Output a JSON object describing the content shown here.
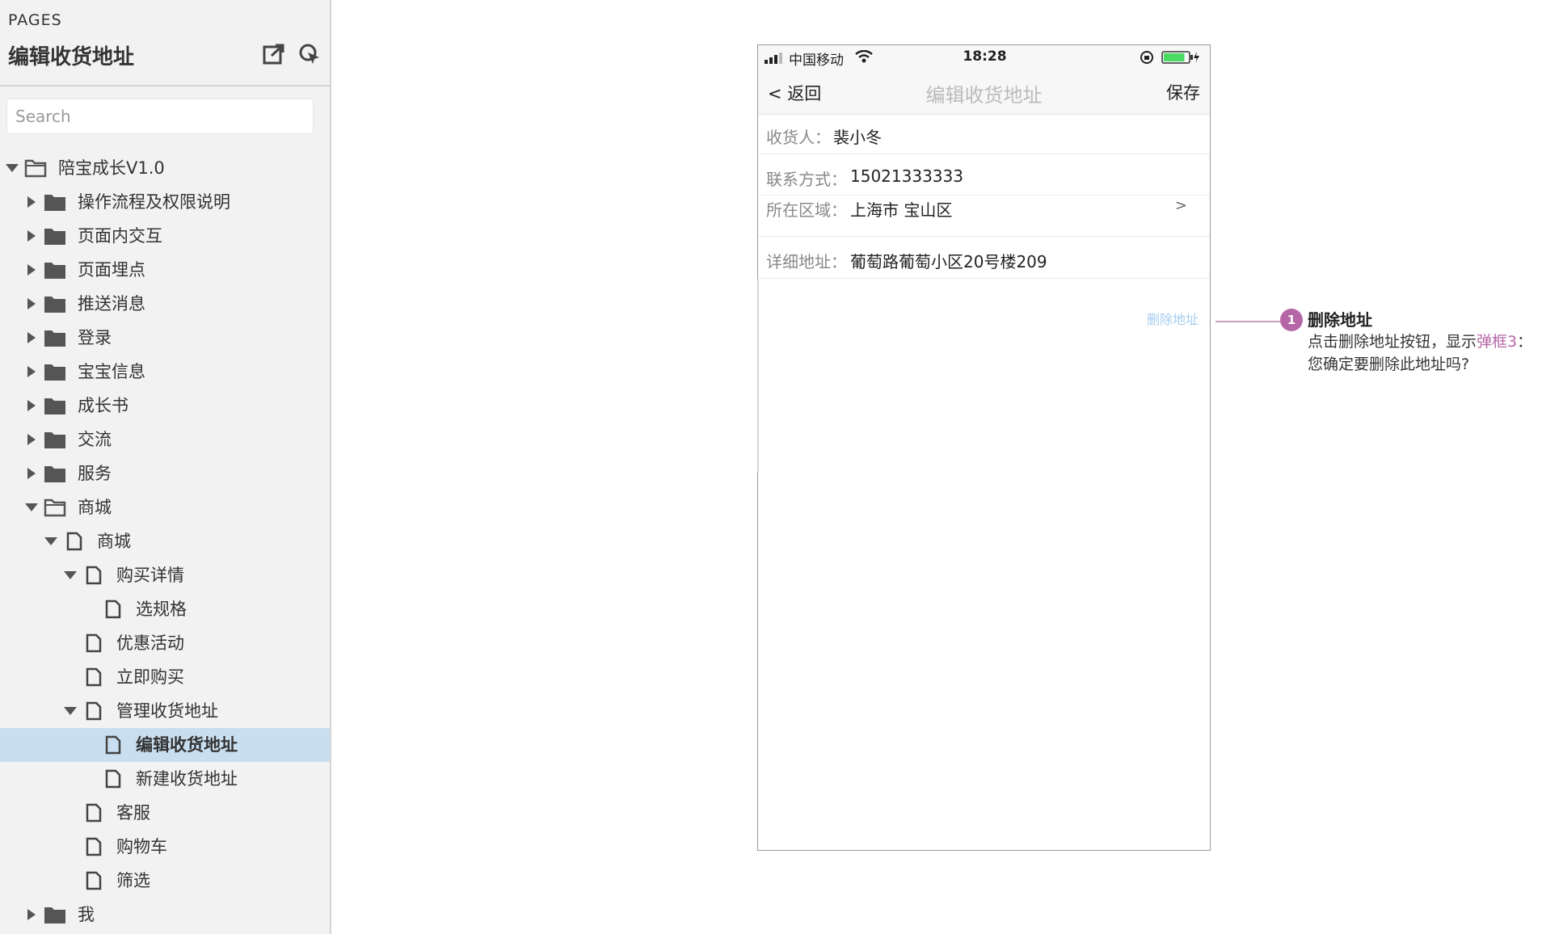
{
  "sidebar": {
    "pages_label": "PAGES",
    "title": "编辑收货地址",
    "search_placeholder": "Search",
    "tree": [
      {
        "label": "陪宝成长V1.0",
        "indent": 0,
        "arrow": "down",
        "icon": "folder-open"
      },
      {
        "label": "操作流程及权限说明",
        "indent": 1,
        "arrow": "right",
        "icon": "folder"
      },
      {
        "label": "页面内交互",
        "indent": 1,
        "arrow": "right",
        "icon": "folder"
      },
      {
        "label": "页面埋点",
        "indent": 1,
        "arrow": "right",
        "icon": "folder"
      },
      {
        "label": "推送消息",
        "indent": 1,
        "arrow": "right",
        "icon": "folder"
      },
      {
        "label": "登录",
        "indent": 1,
        "arrow": "right",
        "icon": "folder"
      },
      {
        "label": "宝宝信息",
        "indent": 1,
        "arrow": "right",
        "icon": "folder"
      },
      {
        "label": "成长书",
        "indent": 1,
        "arrow": "right",
        "icon": "folder"
      },
      {
        "label": "交流",
        "indent": 1,
        "arrow": "right",
        "icon": "folder"
      },
      {
        "label": "服务",
        "indent": 1,
        "arrow": "right",
        "icon": "folder"
      },
      {
        "label": "商城",
        "indent": 1,
        "arrow": "down",
        "icon": "folder-open"
      },
      {
        "label": "商城",
        "indent": 2,
        "arrow": "down",
        "icon": "page"
      },
      {
        "label": "购买详情",
        "indent": 3,
        "arrow": "down",
        "icon": "page"
      },
      {
        "label": "选规格",
        "indent": 4,
        "arrow": "none",
        "icon": "page"
      },
      {
        "label": "优惠活动",
        "indent": 3,
        "arrow": "none",
        "icon": "page"
      },
      {
        "label": "立即购买",
        "indent": 3,
        "arrow": "none",
        "icon": "page"
      },
      {
        "label": "管理收货地址",
        "indent": 3,
        "arrow": "down",
        "icon": "page"
      },
      {
        "label": "编辑收货地址",
        "indent": 4,
        "arrow": "none",
        "icon": "page",
        "selected": true
      },
      {
        "label": "新建收货地址",
        "indent": 4,
        "arrow": "none",
        "icon": "page"
      },
      {
        "label": "客服",
        "indent": 3,
        "arrow": "none",
        "icon": "page"
      },
      {
        "label": "购物车",
        "indent": 3,
        "arrow": "none",
        "icon": "page"
      },
      {
        "label": "筛选",
        "indent": 3,
        "arrow": "none",
        "icon": "page"
      },
      {
        "label": "我",
        "indent": 1,
        "arrow": "right",
        "icon": "folder"
      }
    ]
  },
  "phone": {
    "status": {
      "carrier": "中国移动",
      "time": "18:28",
      "battery_level": 0.85
    },
    "nav": {
      "back": "< 返回",
      "title": "编辑收货地址",
      "save": "保存"
    },
    "fields": {
      "recipient_label": "收货人：",
      "recipient_value": "裴小冬",
      "contact_label": "联系方式：",
      "contact_value": "15021333333",
      "region_label": "所在区域：",
      "region_value": "上海市 宝山区",
      "region_chevron": ">",
      "address_label": "详细地址：",
      "address_value": "葡萄路葡萄小区20号楼209"
    },
    "delete_link": "删除地址"
  },
  "annotation": {
    "badge": "1",
    "title": "删除地址",
    "line1_pre": "点击删除地址按钮，显示",
    "line1_link": "弹框3",
    "line1_post": "：",
    "line2": "您确定要删除此地址吗?"
  },
  "colors": {
    "selected_row": "#c9dff0",
    "annotation_accent": "#b566a6",
    "delete_link": "#a6cdf0",
    "battery": "#4cd964"
  }
}
